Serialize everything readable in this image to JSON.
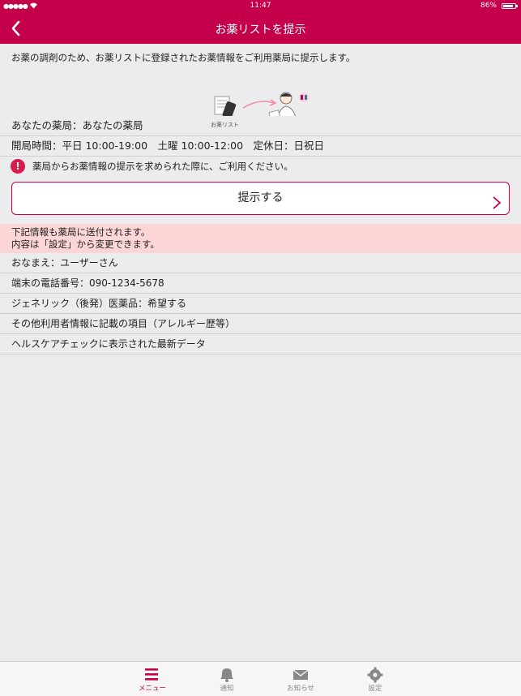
{
  "status_bar": {
    "signal": "●●●●●",
    "wifi": "wifi-icon",
    "time": "11:47",
    "battery": "86%"
  },
  "nav": {
    "title": "お薬リストを提示",
    "back_icon": "chevron-left-icon"
  },
  "intro": "お薬の調剤のため、お薬リストに登録されたお薬情報をご利用薬局に提示します。",
  "illustration": {
    "caption": "お薬リスト"
  },
  "pharmacy": {
    "name_row": "あなたの薬局：あなたの薬局",
    "hours_row": "開局時間：平日 10:00-19:00　土曜 10:00-12:00　定休日：日祝日"
  },
  "notice": {
    "icon": "!",
    "text": "薬局からお薬情報の提示を求められた際に、ご利用ください。"
  },
  "present_button": {
    "label": "提示する"
  },
  "info_band": {
    "line1": "下記情報も薬局に送付されます。",
    "line2": "内容は「設定」から変更できます。"
  },
  "items": [
    "おなまえ：ユーザーさん",
    "端末の電話番号：090-1234-5678",
    "ジェネリック（後発）医薬品：希望する",
    "その他利用者情報に記載の項目（アレルギー歴等）",
    "ヘルスケアチェックに表示された最新データ"
  ],
  "tabs": [
    {
      "label": "メニュー",
      "icon": "menu-icon",
      "active": true
    },
    {
      "label": "通知",
      "icon": "bell-icon",
      "active": false
    },
    {
      "label": "お知らせ",
      "icon": "mail-icon",
      "active": false
    },
    {
      "label": "設定",
      "icon": "gear-icon",
      "active": false
    }
  ],
  "colors": {
    "brand": "#c4004a",
    "info_band": "#fcd6d6",
    "alert": "#d81b4e"
  }
}
